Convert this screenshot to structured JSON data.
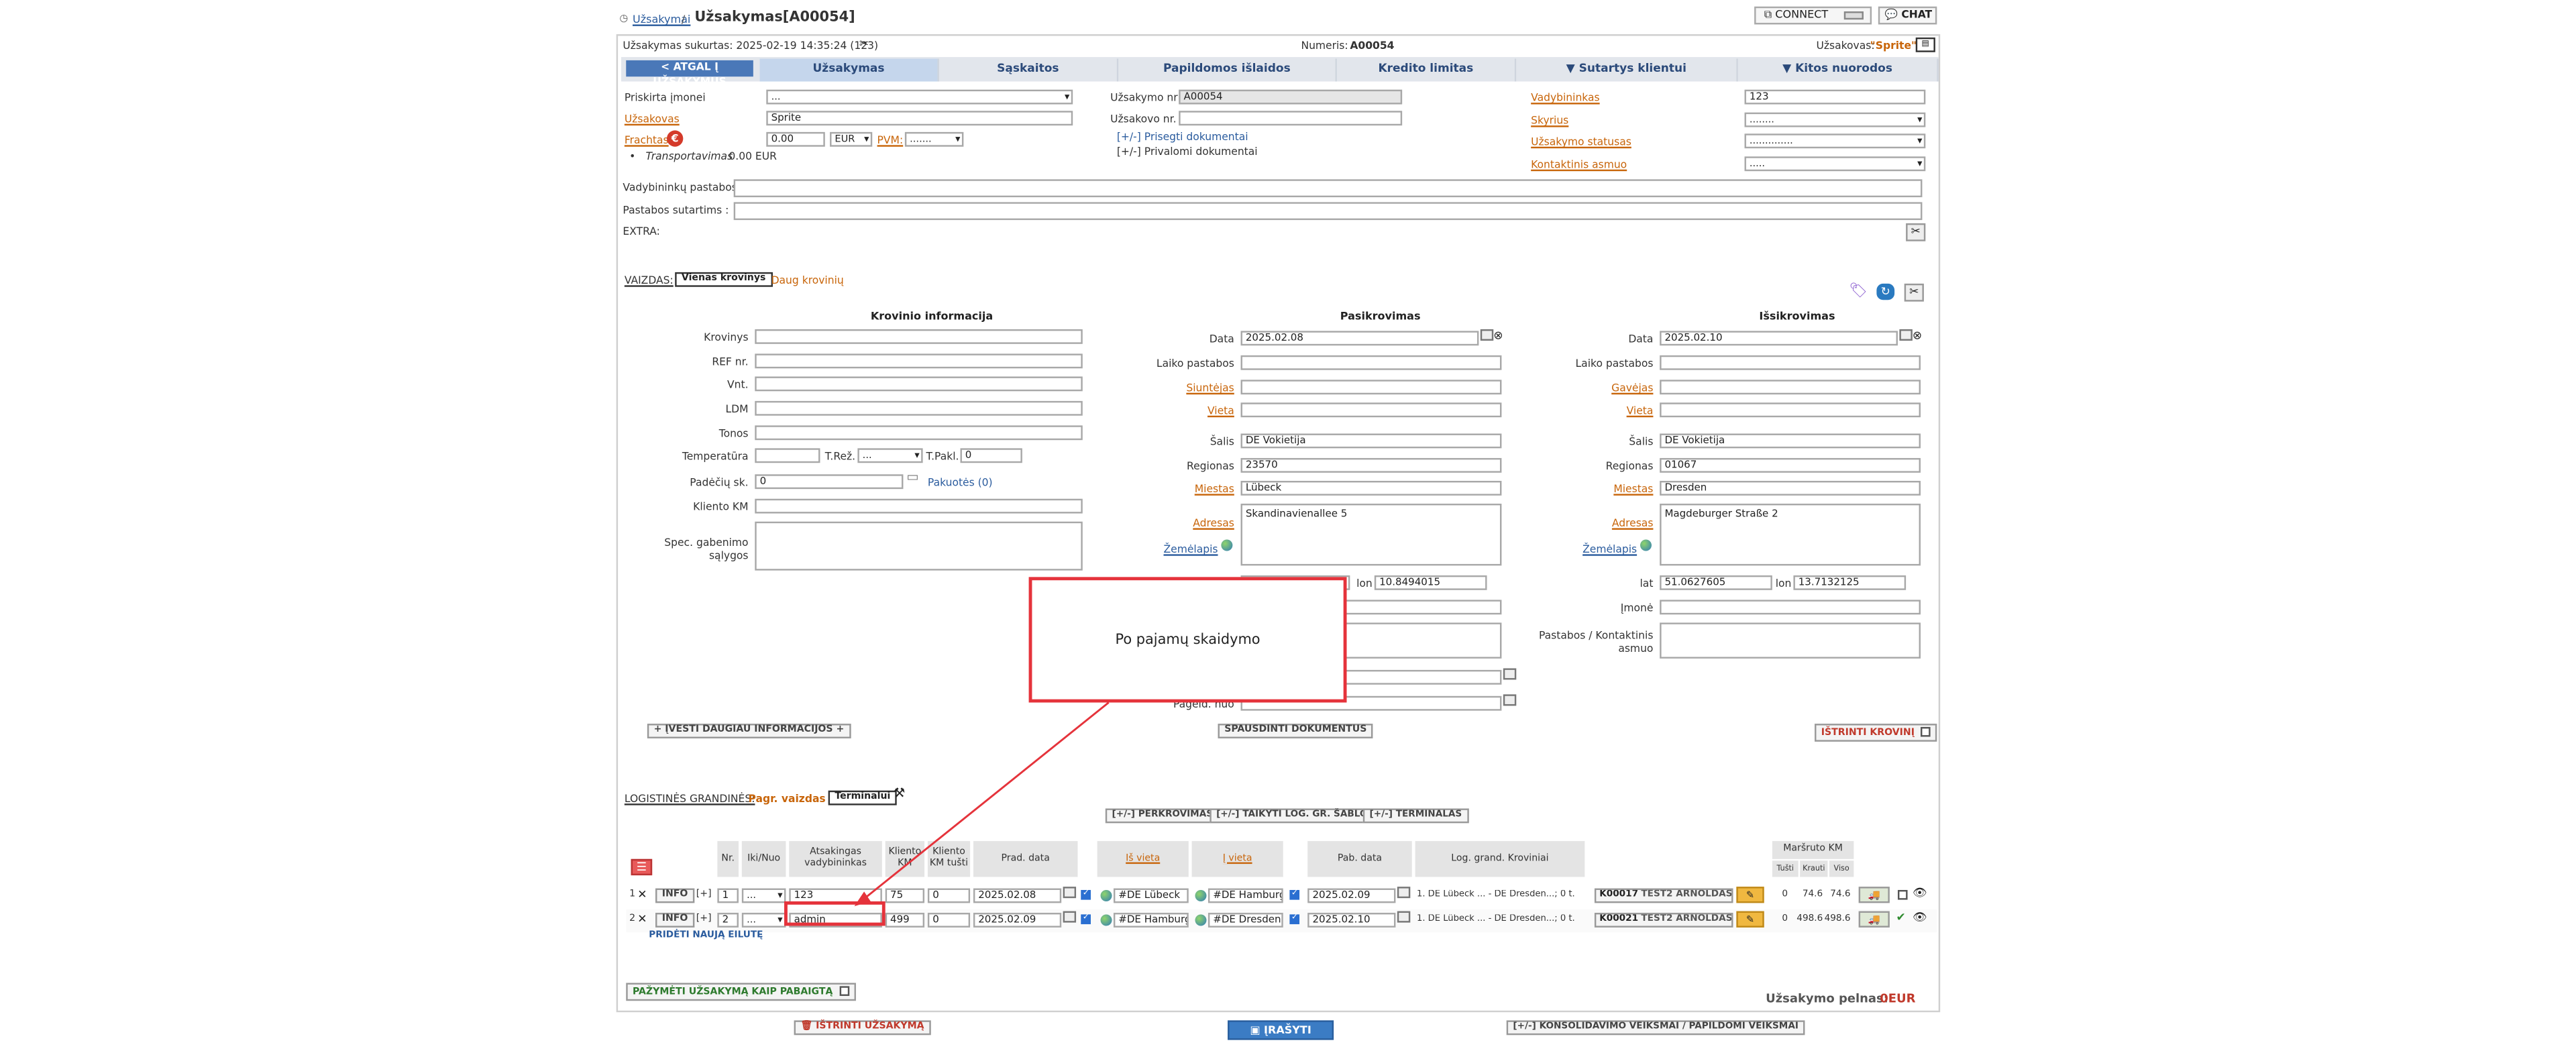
{
  "header": {
    "breadcrumb_root": "Užsakymai",
    "breadcrumb_sep": "/",
    "title": "Užsakymas[A00054]",
    "connect_label": "CONNECT",
    "chat_label": "CHAT"
  },
  "infobar": {
    "created": "Užsakymas sukurtas: 2025-02-19 14:35:24 (123)",
    "number_label": "Numeris:",
    "number": "A00054",
    "client_label": "Užsakovas:",
    "client": "\"Sprite\""
  },
  "tabs": [
    "< ATGAL Į UŽSAKYMUS",
    "Užsakymas",
    "Sąskaitos",
    "Papildomos išlaidos",
    "Kredito limitas",
    "▼ Sutartys klientui",
    "▼ Kitos nuorodos"
  ],
  "form": {
    "assign_label": "Priskirta įmonei",
    "assign_value": "...",
    "client_label": "Užsakovas",
    "client_value": "Sprite",
    "freight_label": "Frachtas",
    "freight_value": "0.00",
    "currency": "EUR",
    "vat_label": "PVM:",
    "vat_value": ".......",
    "transport_label": "Transportavimas",
    "transport_value": "0.00 EUR",
    "order_nr_label": "Užsakymo nr",
    "order_nr": "A00054",
    "client_order_label": "Užsakovo nr. :",
    "attach_docs": "[+/-] Prisegti dokumentai",
    "private_docs": "[+/-] Privalomi dokumentai",
    "manager_label": "Vadybininkas",
    "manager_value": "123",
    "dept_label": "Skyrius",
    "dept_value": "........",
    "status_label": "Užsakymo statusas",
    "status_value": "..............",
    "contact_label": "Kontaktinis asmuo",
    "contact_value": ".....",
    "mgr_notes_label": "Vadybininkų pastabos :",
    "contract_notes_label": "Pastabos sutartims :",
    "extra_label": "EXTRA:"
  },
  "views": {
    "label": "VAIZDAS:",
    "single": "Vienas krovinys",
    "multi": "Daug krovinių"
  },
  "cargo": {
    "title": "Krovinio informacija",
    "cargo_label": "Krovinys",
    "ref_label": "REF nr.",
    "units_label": "Vnt.",
    "ldm_label": "LDM",
    "tons_label": "Tonos",
    "temp_label": "Temperatūra",
    "treg_label": "T.Rež.",
    "treg_value": "...",
    "tpak_label": "T.Pakl.",
    "tpak_value": "0",
    "pallets_label": "Padėčių sk.",
    "pallets_value": "0",
    "packages": "Pakuotės (0)",
    "km_label": "Kliento KM",
    "cond_label": "Spec. gabenimo sąlygos"
  },
  "loading": {
    "title": "Pasikrovimas",
    "date_label": "Data",
    "date": "2025.02.08",
    "time_label": "Laiko pastabos",
    "sender_label": "Siuntėjas",
    "place_label": "Vieta",
    "country_label": "Šalis",
    "country": "DE Vokietija",
    "region_label": "Regionas",
    "region": "23570",
    "city_label": "Miestas",
    "city": "Lübeck",
    "address_label": "Adresas",
    "address": "Skandinavienallee 5",
    "map_label": "Žemėlapis",
    "lon_label": "lon",
    "lon": "10.8494015",
    "from_label": "Pageid. nuo"
  },
  "unloading": {
    "title": "Išsikrovimas",
    "date_label": "Data",
    "date": "2025.02.10",
    "time_label": "Laiko pastabos",
    "receiver_label": "Gavėjas",
    "place_label": "Vieta",
    "country_label": "Šalis",
    "country": "DE Vokietija",
    "region_label": "Regionas",
    "region": "01067",
    "city_label": "Miestas",
    "city": "Dresden",
    "address_label": "Adresas",
    "address": "Magdeburger Straße 2",
    "map_label": "Žemėlapis",
    "lat_label": "lat",
    "lat": "51.0627605",
    "lon_label": "lon",
    "lon": "13.7132125",
    "company_label": "Įmonė",
    "notes_label": "Pastabos / Kontaktinis asmuo"
  },
  "actions": {
    "more_info": "+ ĮVESTI DAUGIAU INFORMACIJOS +",
    "print_docs": "SPAUSDINTI DOKUMENTUS",
    "delete_cargo": "IŠTRINTI KROVINĮ"
  },
  "logistics": {
    "label": "LOGISTINĖS GRANDINĖS:",
    "main_view": "Pagr. vaizdas",
    "terminal": "Terminalui",
    "reloads": "[+/-] PERKROVIMAS",
    "apply_template": "[+/-] TAIKYTI LOG. GR. ŠABLONA",
    "terminals": "[+/-] TERMINALAS",
    "headers": {
      "nr": "Nr.",
      "iki": "Iki/Nuo",
      "mgr": "Atsakingas vadybininkas",
      "km": "Klientо KM",
      "km_empty": "Kliento KM tušti",
      "start": "Prad. data",
      "from": "Iš vieta",
      "to": "Į vieta",
      "unload_date": "Pab. data",
      "chain": "Log. grand. Kroviniai",
      "route": "Maršruto KM",
      "route_empty": "Tušti",
      "route_loaded": "Krauti",
      "route_total": "Viso"
    },
    "rows": [
      {
        "idx": "1",
        "info": "INFO",
        "plus": "[+]",
        "nr": "1",
        "iki": "...",
        "mgr": "123",
        "km": "75",
        "km_empty": "0",
        "start": "2025.02.08",
        "from": "#DE Lübeck",
        "to": "#DE Hamburg",
        "end": "2025.02.09",
        "chain": "1. DE Lübeck ... - DE Dresden...; 0 t.",
        "carrier_code": "K00017",
        "carrier": "TEST2 ARNOLDAS",
        "e": "0",
        "l": "74.6",
        "t": "74.6"
      },
      {
        "idx": "2",
        "info": "INFO",
        "plus": "[+]",
        "nr": "2",
        "iki": "...",
        "mgr": "admin",
        "km": "499",
        "km_empty": "0",
        "start": "2025.02.09",
        "from": "#DE Hamburg",
        "to": "#DE Dresden",
        "end": "2025.02.10",
        "chain": "1. DE Lübeck ... - DE Dresden...; 0 t.",
        "carrier_code": "K00021",
        "carrier": "TEST2 ARNOLDAS",
        "e": "0",
        "l": "498.6",
        "t": "498.6"
      }
    ],
    "add_link": "PRIDĖTI NAUJĄ EILUTĘ"
  },
  "footer": {
    "complete": "PAŽYMĖTI UŽSAKYMĄ KAIP PABAIGTĄ",
    "profit_label": "Užsakymo pelnas:",
    "profit": "0EUR",
    "delete_order": "IŠTRINTI UŽSAKYMĄ",
    "save": "ĮRAŠYTI",
    "consolidate": "[+/-] KONSOLIDAVIMO VEIKSMAI / PAPILDOMI VEIKSMAI"
  },
  "callout": {
    "text": "Po pajamų skaidymo"
  }
}
